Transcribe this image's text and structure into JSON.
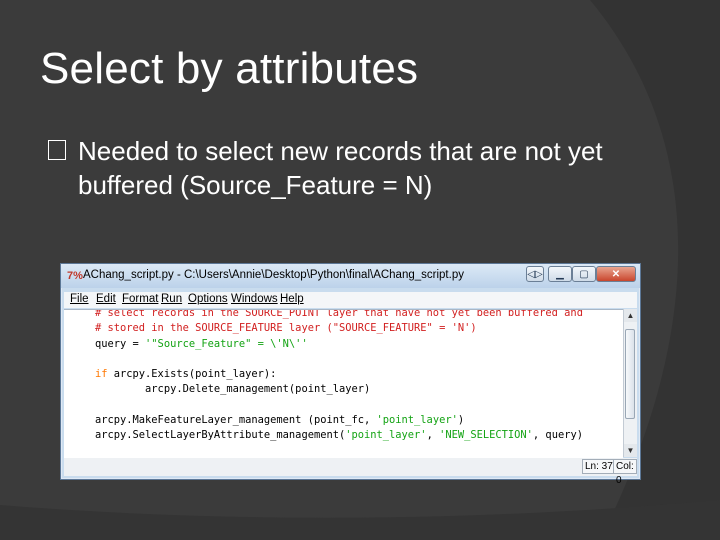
{
  "slide": {
    "title": "Select by attributes",
    "bullet": "Needed to select new records that are not yet buffered (Source_Feature = N)"
  },
  "window": {
    "title": "AChang_script.py - C:\\Users\\Annie\\Desktop\\Python\\final\\AChang_script.py",
    "app_icon": "idle-python-icon",
    "menu": [
      "File",
      "Edit",
      "Format",
      "Run",
      "Options",
      "Windows",
      "Help"
    ],
    "controls": {
      "restore": "restore-icon",
      "minimize": "minimize-icon",
      "maximize": "maximize-icon",
      "close": "close-icon"
    },
    "code_lines": [
      {
        "segments": [
          {
            "t": "# select records in the SOURCE_POINT layer that have not yet been buffered and",
            "c": "comment"
          }
        ]
      },
      {
        "segments": [
          {
            "t": "# stored in the SOURCE_FEATURE layer (\"SOURCE_FEATURE\" = 'N')",
            "c": "comment"
          }
        ]
      },
      {
        "segments": [
          {
            "t": "query = ",
            "c": ""
          },
          {
            "t": "'\"Source_Feature\" = \\'N\\''",
            "c": "string"
          }
        ]
      },
      {
        "segments": [
          {
            "t": "",
            "c": ""
          }
        ]
      },
      {
        "segments": [
          {
            "t": "if",
            "c": "kw"
          },
          {
            "t": " arcpy.Exists(point_layer):",
            "c": ""
          }
        ]
      },
      {
        "segments": [
          {
            "t": "        arcpy.Delete_management(point_layer)",
            "c": ""
          }
        ]
      },
      {
        "segments": [
          {
            "t": "",
            "c": ""
          }
        ]
      },
      {
        "segments": [
          {
            "t": "arcpy.MakeFeatureLayer_management (point_fc, ",
            "c": ""
          },
          {
            "t": "'point_layer'",
            "c": "string"
          },
          {
            "t": ")",
            "c": ""
          }
        ]
      },
      {
        "segments": [
          {
            "t": "arcpy.SelectLayerByAttribute_management(",
            "c": ""
          },
          {
            "t": "'point_layer'",
            "c": "string"
          },
          {
            "t": ", ",
            "c": ""
          },
          {
            "t": "'NEW_SELECTION'",
            "c": "string"
          },
          {
            "t": ", query)",
            "c": ""
          }
        ]
      }
    ],
    "status": {
      "line": "Ln: 37",
      "col": "Col: 0"
    }
  }
}
